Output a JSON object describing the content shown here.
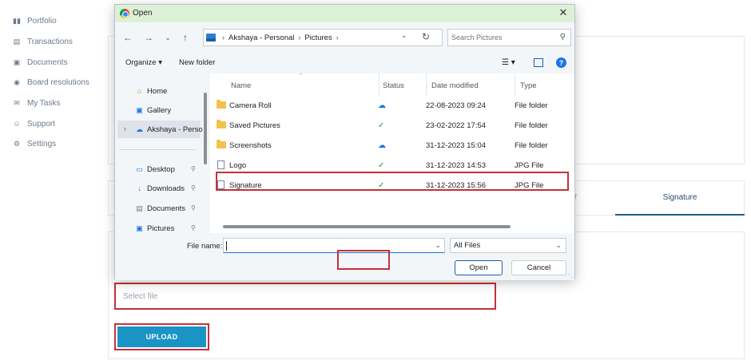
{
  "sidebar": {
    "items": [
      {
        "label": "Portfolio",
        "icon": "portfolio-icon"
      },
      {
        "label": "Transactions",
        "icon": "clipboard-icon"
      },
      {
        "label": "Documents",
        "icon": "document-icon"
      },
      {
        "label": "Board resolutions",
        "icon": "gavel-icon"
      },
      {
        "label": "My Tasks",
        "icon": "envelope-icon"
      },
      {
        "label": "Support",
        "icon": "support-icon"
      },
      {
        "label": "Settings",
        "icon": "gear-icon"
      }
    ]
  },
  "main": {
    "tab_fragment": "r",
    "tab_signature": "Signature",
    "select_file_placeholder": "Select file",
    "upload_label": "UPLOAD"
  },
  "dialog": {
    "title": "Open",
    "breadcrumb": [
      "Akshaya - Personal",
      "Pictures"
    ],
    "search_placeholder": "Search Pictures",
    "toolbar": {
      "organize": "Organize",
      "new_folder": "New folder"
    },
    "nav_pane": [
      {
        "label": "Home",
        "icon": "home-icon"
      },
      {
        "label": "Gallery",
        "icon": "gallery-icon"
      },
      {
        "label": "Akshaya - Perso",
        "icon": "cloud-icon"
      },
      {
        "label": "Desktop",
        "icon": "desktop-icon"
      },
      {
        "label": "Downloads",
        "icon": "download-icon"
      },
      {
        "label": "Documents",
        "icon": "document-icon"
      },
      {
        "label": "Pictures",
        "icon": "pictures-icon"
      }
    ],
    "columns": {
      "name": "Name",
      "status": "Status",
      "date": "Date modified",
      "type": "Type"
    },
    "files": [
      {
        "name": "Camera Roll",
        "kind": "folder",
        "status": "cloud",
        "date": "22-08-2023 09:24",
        "type": "File folder"
      },
      {
        "name": "Saved Pictures",
        "kind": "folder",
        "status": "synced",
        "date": "23-02-2022 17:54",
        "type": "File folder"
      },
      {
        "name": "Screenshots",
        "kind": "folder",
        "status": "cloud",
        "date": "31-12-2023 15:04",
        "type": "File folder"
      },
      {
        "name": "Logo",
        "kind": "jpg",
        "status": "synced",
        "date": "31-12-2023 14:53",
        "type": "JPG File"
      },
      {
        "name": "Signature",
        "kind": "jpg",
        "status": "synced",
        "date": "31-12-2023 15:56",
        "type": "JPG File"
      }
    ],
    "file_name_label": "File name:",
    "file_name_value": "",
    "filter": "All Files",
    "open_label": "Open",
    "cancel_label": "Cancel"
  },
  "colors": {
    "highlight": "#c62f3a",
    "upload": "#1a94c4",
    "titlebar": "#dcf0d7"
  }
}
